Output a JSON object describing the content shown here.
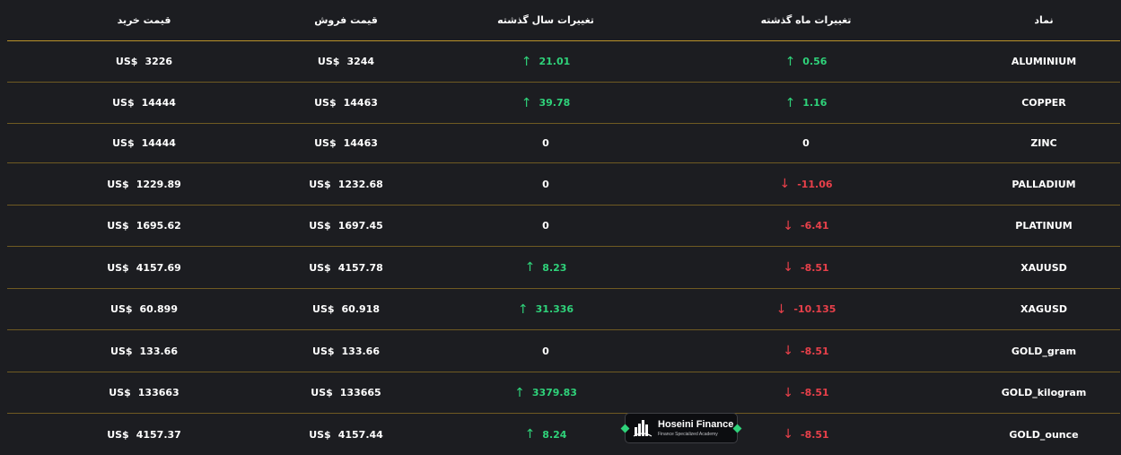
{
  "table": {
    "headers": {
      "buy": "قیمت خرید",
      "sell": "قیمت فروش",
      "year_change": "تغییرات سال گذشته",
      "month_change": "تغییرات ماه گذشته",
      "symbol": "نماد"
    },
    "currency": "US$",
    "rows": [
      {
        "symbol": "ALUMINIUM",
        "month": "0.56",
        "month_dir": "up",
        "year": "21.01",
        "year_dir": "up",
        "sell": "3244",
        "buy": "3226"
      },
      {
        "symbol": "COPPER",
        "month": "1.16",
        "month_dir": "up",
        "year": "39.78",
        "year_dir": "up",
        "sell": "14463",
        "buy": "14444"
      },
      {
        "symbol": "ZINC",
        "month": "0",
        "month_dir": "zero",
        "year": "0",
        "year_dir": "zero",
        "sell": "14463",
        "buy": "14444"
      },
      {
        "symbol": "PALLADIUM",
        "month": "-11.06",
        "month_dir": "down",
        "year": "0",
        "year_dir": "zero",
        "sell": "1232.68",
        "buy": "1229.89"
      },
      {
        "symbol": "PLATINUM",
        "month": "-6.41",
        "month_dir": "down",
        "year": "0",
        "year_dir": "zero",
        "sell": "1697.45",
        "buy": "1695.62"
      },
      {
        "symbol": "XAUUSD",
        "month": "-8.51",
        "month_dir": "down",
        "year": "8.23",
        "year_dir": "up",
        "sell": "4157.78",
        "buy": "4157.69"
      },
      {
        "symbol": "XAGUSD",
        "month": "-10.135",
        "month_dir": "down",
        "year": "31.336",
        "year_dir": "up",
        "sell": "60.918",
        "buy": "60.899"
      },
      {
        "symbol": "GOLD_gram",
        "month": "-8.51",
        "month_dir": "down",
        "year": "0",
        "year_dir": "zero",
        "sell": "133.66",
        "buy": "133.66"
      },
      {
        "symbol": "GOLD_kilogram",
        "month": "-8.51",
        "month_dir": "down",
        "year": "3379.83",
        "year_dir": "up",
        "sell": "133665",
        "buy": "133663"
      },
      {
        "symbol": "GOLD_ounce",
        "month": "-8.51",
        "month_dir": "down",
        "year": "8.24",
        "year_dir": "up",
        "sell": "4157.44",
        "buy": "4157.37"
      }
    ]
  },
  "watermark": {
    "title": "Hoseini Finance",
    "subtitle": "Finance Specialized Academy"
  },
  "colors": {
    "up": "#2fd27a",
    "down": "#e8404a",
    "divider": "#b8912a",
    "background": "#1c1d21"
  },
  "icons": {
    "up": "arrow-up-icon",
    "down": "arrow-down-icon"
  }
}
